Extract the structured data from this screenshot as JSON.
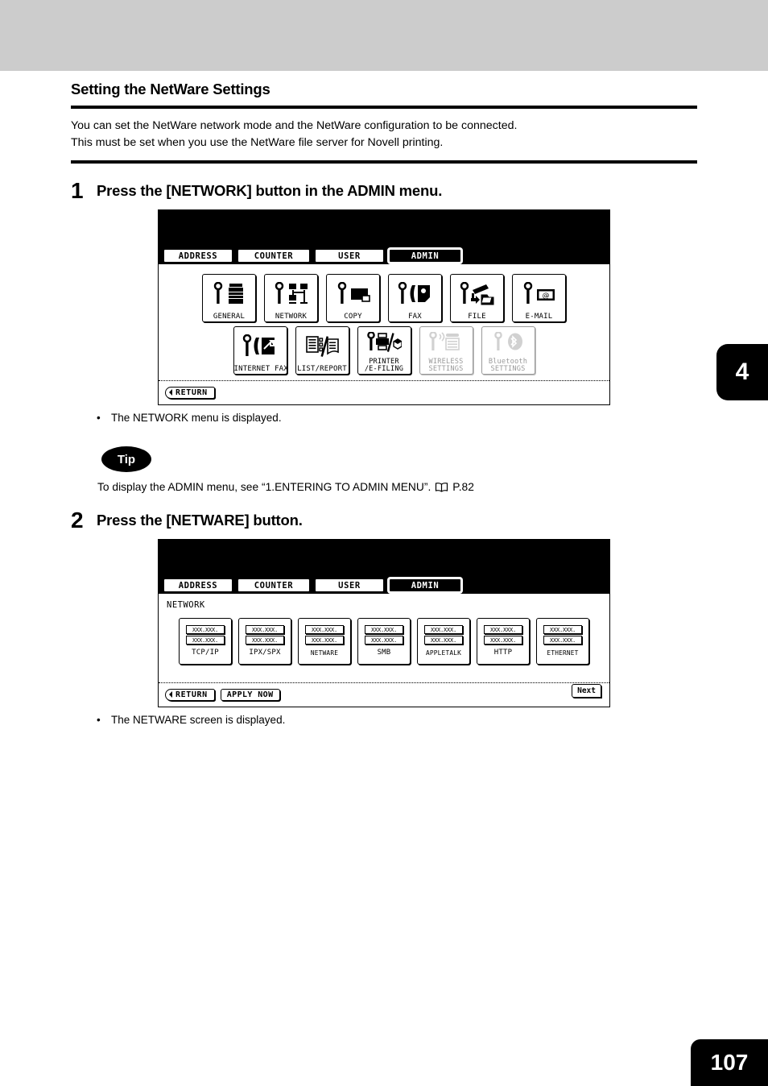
{
  "section": {
    "title": "Setting the NetWare Settings",
    "intro_line1": "You can set the NetWare network mode and the NetWare configuration to be connected.",
    "intro_line2": "This must be set when you use the NetWare file server for Novell printing."
  },
  "chapter_tab": "4",
  "page_number": "107",
  "step1": {
    "number": "1",
    "instruction": "Press the [NETWORK] button in the ADMIN menu.",
    "note": "The NETWORK menu is displayed.",
    "bullet": "•"
  },
  "step2": {
    "number": "2",
    "instruction": "Press the [NETWARE] button.",
    "note": "The NETWARE screen is displayed.",
    "bullet": "•"
  },
  "tip": {
    "label": "Tip",
    "text": "To display the ADMIN menu, see “1.ENTERING TO ADMIN MENU”.",
    "page_ref": "P.82",
    "icon": "book-icon"
  },
  "admin_screen": {
    "tabs": [
      {
        "label": "ADDRESS",
        "active": false
      },
      {
        "label": "COUNTER",
        "active": false
      },
      {
        "label": "USER",
        "active": false
      },
      {
        "label": "ADMIN",
        "active": true
      }
    ],
    "buttons_row1": [
      {
        "label": "GENERAL",
        "icon": "wrench-copier-icon",
        "disabled": false
      },
      {
        "label": "NETWORK",
        "icon": "wrench-network-icon",
        "disabled": false
      },
      {
        "label": "COPY",
        "icon": "wrench-page-icon",
        "disabled": false
      },
      {
        "label": "FAX",
        "icon": "wrench-fax-icon",
        "disabled": false
      },
      {
        "label": "FILE",
        "icon": "wrench-folder-icon",
        "disabled": false
      },
      {
        "label": "E-MAIL",
        "icon": "wrench-envelope-at-icon",
        "disabled": false
      }
    ],
    "buttons_row2": [
      {
        "label": "INTERNET FAX",
        "label2": "",
        "icon": "wrench-internet-fax-icon",
        "disabled": false
      },
      {
        "label": "LIST/REPORT",
        "label2": "",
        "icon": "list-report-icon",
        "disabled": false
      },
      {
        "label": "PRINTER",
        "label2": "/E-FILING",
        "icon": "wrench-printer-efiling-icon",
        "disabled": false
      },
      {
        "label": "WIRELESS",
        "label2": "SETTINGS",
        "icon": "wrench-wireless-icon",
        "disabled": true
      },
      {
        "label": "Bluetooth",
        "label2": "SETTINGS",
        "icon": "wrench-bluetooth-icon",
        "disabled": true
      }
    ],
    "return_label": "RETURN"
  },
  "netware_screen": {
    "tabs": [
      {
        "label": "ADDRESS",
        "active": false
      },
      {
        "label": "COUNTER",
        "active": false
      },
      {
        "label": "USER",
        "active": false
      },
      {
        "label": "ADMIN",
        "active": true
      }
    ],
    "screen_label": "NETWORK",
    "placeholder_line1": "XXX.XXX.",
    "placeholder_line2": "XXX.XXX.",
    "options": [
      {
        "label": "TCP/IP"
      },
      {
        "label": "IPX/SPX"
      },
      {
        "label": "NETWARE"
      },
      {
        "label": "SMB"
      },
      {
        "label": "APPLETALK"
      },
      {
        "label": "HTTP"
      },
      {
        "label": "ETHERNET"
      }
    ],
    "return_label": "RETURN",
    "apply_label": "APPLY NOW",
    "next_label": "Next"
  }
}
